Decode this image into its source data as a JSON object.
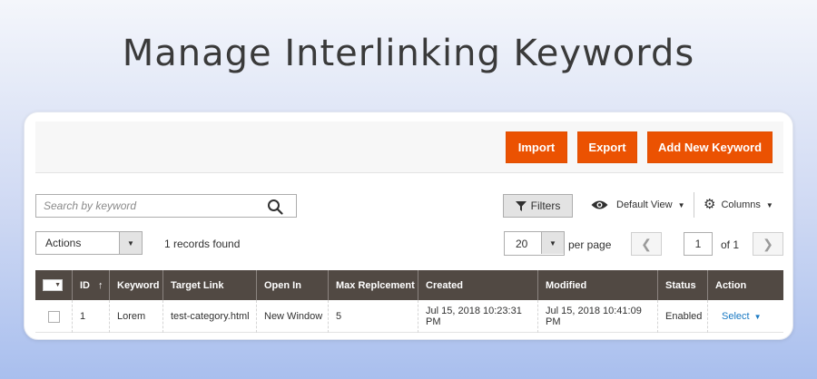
{
  "page": {
    "title": "Manage Interlinking Keywords"
  },
  "toolbar": {
    "import_label": "Import",
    "export_label": "Export",
    "add_new_label": "Add New Keyword"
  },
  "search": {
    "placeholder": "Search by keyword"
  },
  "controls": {
    "filters_label": "Filters",
    "view_label": "Default View",
    "columns_label": "Columns",
    "actions_label": "Actions",
    "records_found": "1 records found",
    "per_page_value": "20",
    "per_page_label": "per page",
    "current_page": "1",
    "page_total": "of 1"
  },
  "grid": {
    "headers": [
      "ID",
      "Keyword",
      "Target Link",
      "Open In",
      "Max Replcement",
      "Created",
      "Modified",
      "Status",
      "Action"
    ],
    "sort_indicator": "↑",
    "rows": [
      {
        "id": "1",
        "keyword": "Lorem",
        "target_link": "test-category.html",
        "open_in": "New Window",
        "max_replacement": "5",
        "created": "Jul 15, 2018 10:23:31 PM",
        "modified": "Jul 15, 2018 10:41:09 PM",
        "status": "Enabled",
        "action": "Select"
      }
    ]
  },
  "icons": {
    "search": "search-icon",
    "filter": "filter-icon",
    "view": "eye-icon",
    "columns": "gear-icon",
    "prev": "chevron-left-icon",
    "next": "chevron-right-icon"
  },
  "colors": {
    "accent": "#eb5202",
    "header_bg": "#514943",
    "link": "#1979c3"
  }
}
